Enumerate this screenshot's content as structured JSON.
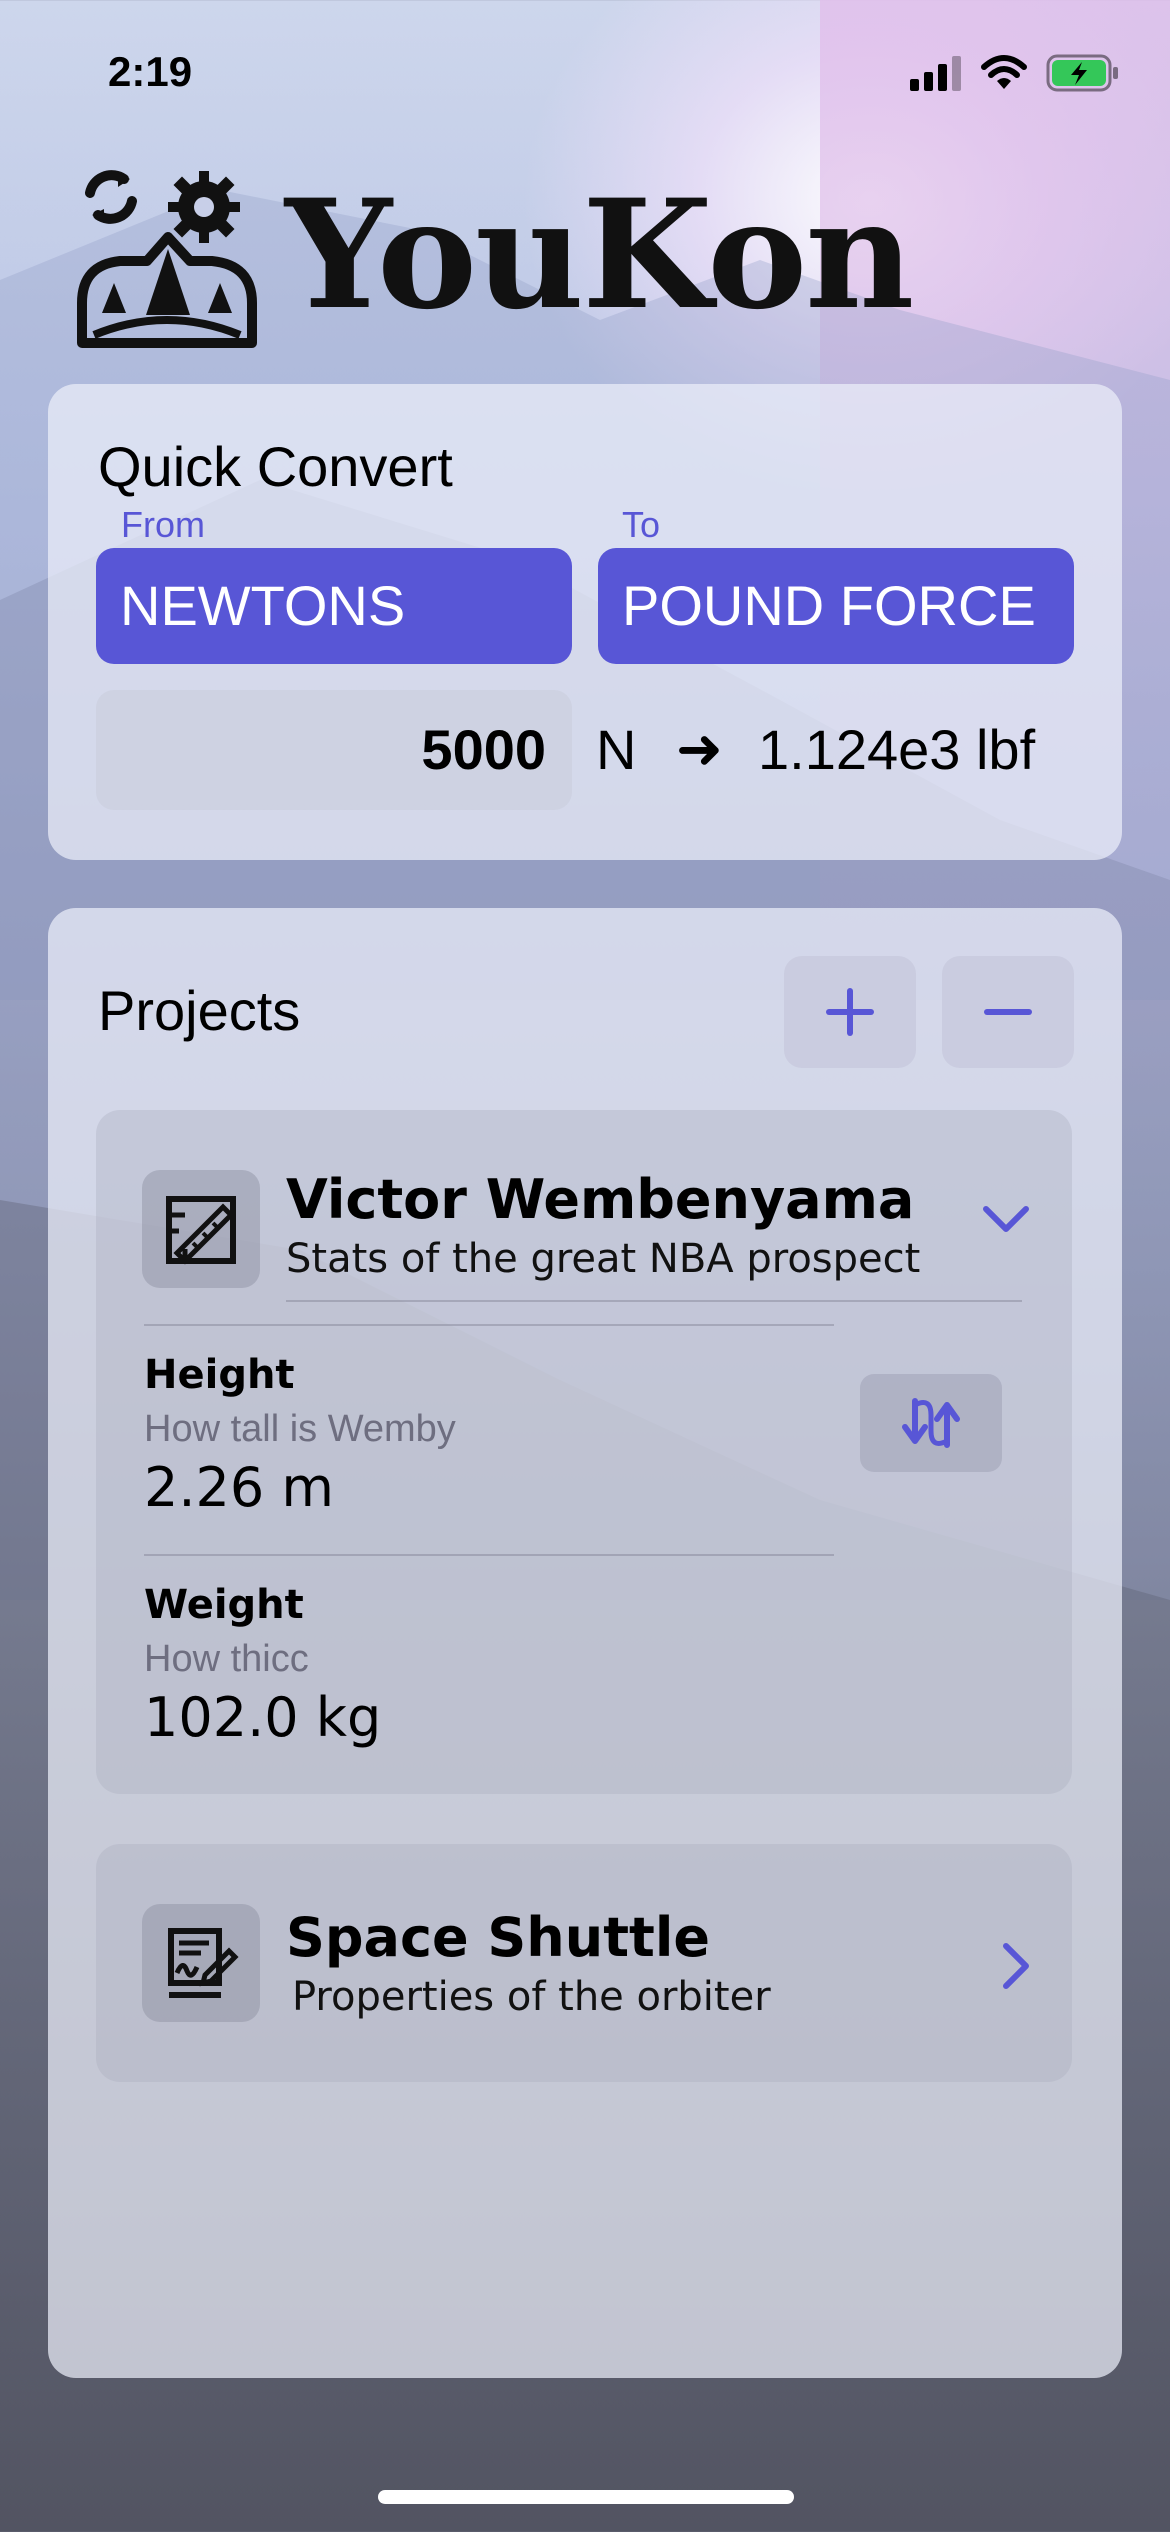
{
  "status_bar": {
    "time": "2:19"
  },
  "app": {
    "name": "YouKon"
  },
  "quick_convert": {
    "title": "Quick Convert",
    "from_label": "From",
    "to_label": "To",
    "from_unit": "NEWTONS",
    "to_unit": "POUND FORCE",
    "value": "5000",
    "value_unit": "N",
    "arrow": "➜",
    "result": "1.124e3 lbf"
  },
  "projects": {
    "title": "Projects",
    "list": [
      {
        "name": "Victor Wembenyama",
        "description": "Stats of the great NBA prospect",
        "expanded": true,
        "icon": "chart-ruler-icon",
        "items": [
          {
            "name": "Height",
            "description": "How tall is Wemby",
            "value": "2.26 m"
          },
          {
            "name": "Weight",
            "description": "How thicc",
            "value": "102.0 kg"
          }
        ]
      },
      {
        "name": "Space Shuttle",
        "description": "Properties of the orbiter",
        "expanded": false,
        "icon": "signed-document-icon"
      }
    ]
  },
  "colors": {
    "accent": "#5856d6"
  }
}
